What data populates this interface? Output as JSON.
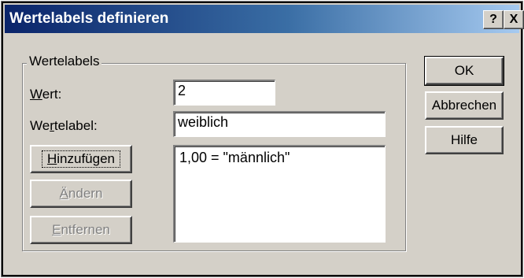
{
  "dialog": {
    "title": "Wertelabels definieren",
    "help_button": "?",
    "close_button": "X"
  },
  "group": {
    "legend": "Wertelabels"
  },
  "fields": {
    "value_label": {
      "pre": "",
      "accel": "W",
      "post": "ert:"
    },
    "value": "2",
    "valuelabel_label": {
      "pre": "We",
      "accel": "r",
      "post": "telabel:"
    },
    "valuelabel": "weiblich"
  },
  "buttons": {
    "add": {
      "pre": "",
      "accel": "H",
      "post": "inzufügen"
    },
    "change": {
      "pre": "",
      "accel": "Ä",
      "post": "ndern"
    },
    "remove": {
      "pre": "",
      "accel": "E",
      "post": "ntfernen"
    },
    "ok": "OK",
    "cancel": "Abbrechen",
    "help": "Hilfe"
  },
  "list": {
    "items": [
      "1,00 = \"männlich\""
    ]
  }
}
